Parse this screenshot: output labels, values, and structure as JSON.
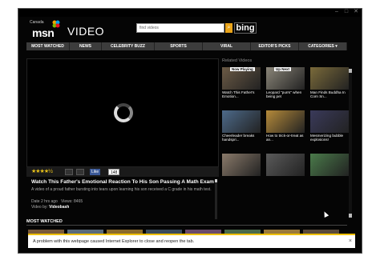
{
  "window": {
    "min": "–",
    "max": "□",
    "close": "✕"
  },
  "header": {
    "region": "Canada",
    "brand": "msn",
    "section": "VIDEO"
  },
  "search": {
    "placeholder": "find videos",
    "button": "⌕",
    "engine": "bing"
  },
  "nav": {
    "items": [
      "MOST WATCHED",
      "NEWS",
      "CELEBRITY BUZZ",
      "SPORTS",
      "VIRAL",
      "EDITOR'S PICKS",
      "CATEGORIES ▾"
    ]
  },
  "player": {
    "rating_stars": "★★★★½",
    "rating": 4.5,
    "like_label": "Like",
    "like_count": "148",
    "title": "Watch This Father's Emotional Reaction To His Son Passing A Math Exam",
    "description": "A video of a proud father bursting into tears upon learning his son received a C grade in his math test.",
    "date_label": "Date",
    "date": "2 hrs ago",
    "views_label": "Views",
    "views": "8465",
    "by_label": "Video by",
    "by": "Videobash"
  },
  "related": {
    "heading": "Related Videos",
    "items": [
      {
        "caption": "Watch This Father's Emotion...",
        "badge": "Now Playing",
        "color": "#6b5a45"
      },
      {
        "caption": "Leopard \"purrs\" when being pet",
        "badge": "Up Next",
        "color": "#8a8578"
      },
      {
        "caption": "Man Finds Buddha In Corn Sn...",
        "badge": "",
        "color": "#7a6a3a"
      },
      {
        "caption": "Cheerleader breaks handspri...",
        "badge": "",
        "color": "#4d6a8a"
      },
      {
        "caption": "How to trick-or-treat as an...",
        "badge": "",
        "color": "#b58a3a"
      },
      {
        "caption": "Mesmerizing bubble explosions!",
        "badge": "",
        "color": "#3a3a5a"
      },
      {
        "caption": "",
        "badge": "",
        "color": "#8a7a6a"
      },
      {
        "caption": "",
        "badge": "",
        "color": "#5a5a5a"
      },
      {
        "caption": "",
        "badge": "",
        "color": "#4a7a4a"
      }
    ]
  },
  "most_watched": {
    "heading": "MOST WATCHED",
    "thumbs": [
      "#7a5a3a",
      "#5a6a7a",
      "#8a6a2a",
      "#3a4a5a",
      "#6a4a6a",
      "#4a6a4a",
      "#9a7a3a",
      "#5a4a3a"
    ]
  },
  "notification": {
    "text": "A problem with this webpage caused Internet Explorer to close and reopen the tab.",
    "close": "×"
  }
}
